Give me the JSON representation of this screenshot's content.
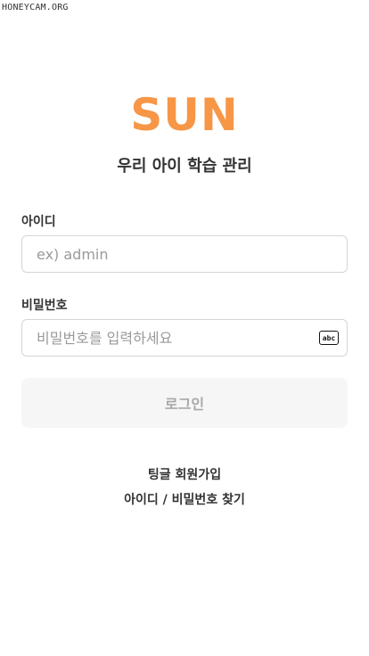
{
  "watermark": "HONEYCAM.ORG",
  "logo": "SUN",
  "subtitle": "우리 아이 학습 관리",
  "form": {
    "id_label": "아이디",
    "id_placeholder": "ex) admin",
    "id_value": "",
    "password_label": "비밀번호",
    "password_placeholder": "비밀번호를 입력하세요",
    "password_value": "",
    "keyboard_icon_text": "abc",
    "login_label": "로그인"
  },
  "links": {
    "signup": "팅글 회원가입",
    "find": "아이디 / 비밀번호 찾기"
  },
  "colors": {
    "brand": "#f79646",
    "button_bg": "#f6f6f6",
    "button_text": "#a9a9a9"
  }
}
